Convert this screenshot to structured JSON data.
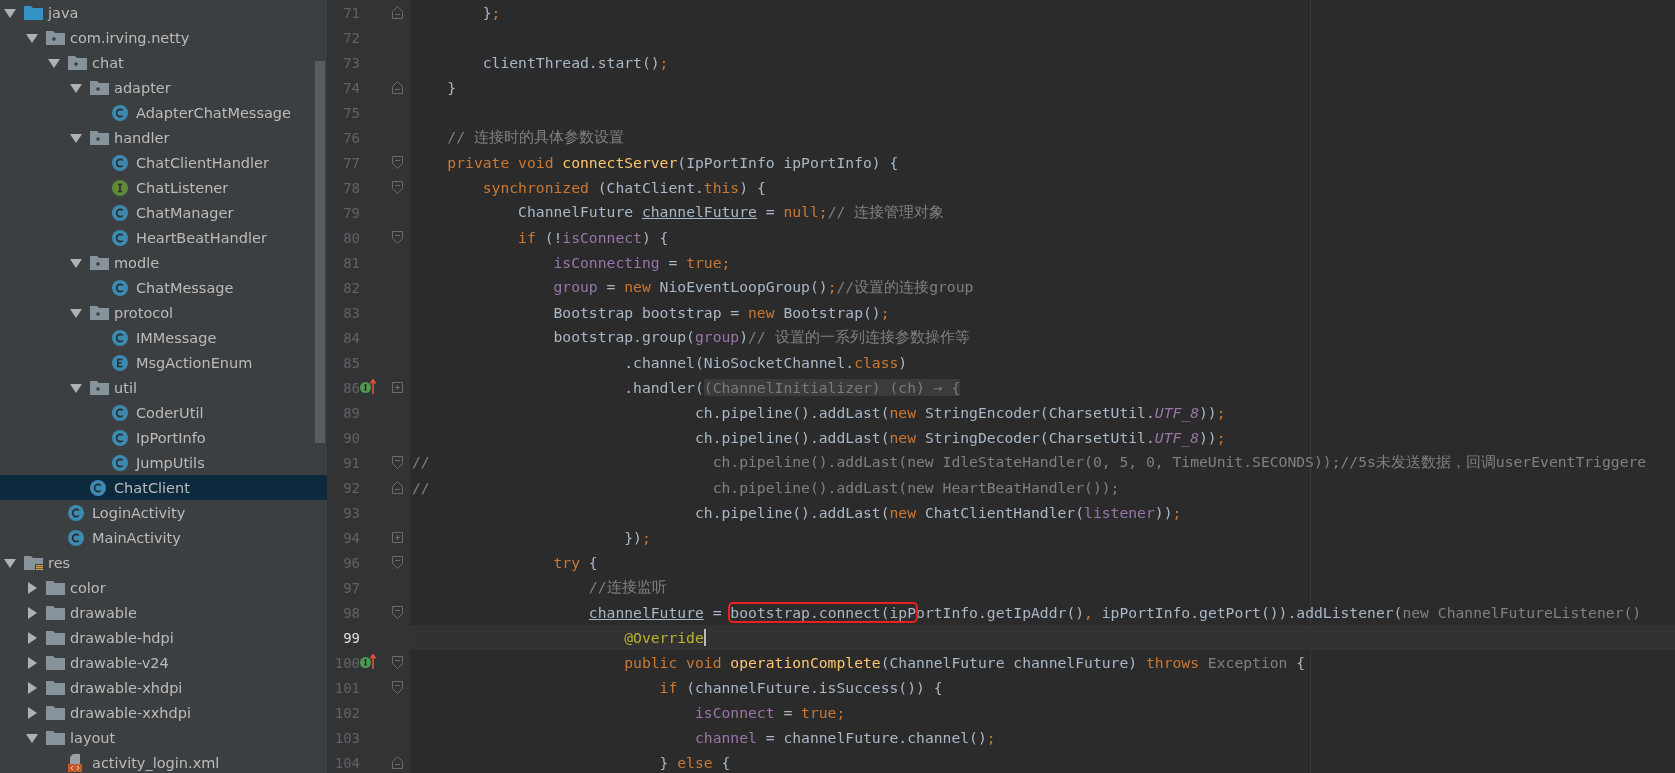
{
  "project_tree": [
    {
      "label": "java",
      "kind": "source-folder",
      "expanded": true,
      "selected": false,
      "children": [
        {
          "label": "com.irving.netty",
          "kind": "package",
          "expanded": true,
          "selected": false,
          "children": [
            {
              "label": "chat",
              "kind": "package",
              "expanded": true,
              "selected": false,
              "children": [
                {
                  "label": "adapter",
                  "kind": "package",
                  "expanded": true,
                  "selected": false,
                  "children": [
                    {
                      "label": "AdapterChatMessage",
                      "kind": "class",
                      "selected": false
                    }
                  ]
                },
                {
                  "label": "handler",
                  "kind": "package",
                  "expanded": true,
                  "selected": false,
                  "children": [
                    {
                      "label": "ChatClientHandler",
                      "kind": "class",
                      "selected": false
                    },
                    {
                      "label": "ChatListener",
                      "kind": "interface",
                      "selected": false
                    },
                    {
                      "label": "ChatManager",
                      "kind": "class",
                      "selected": false
                    },
                    {
                      "label": "HeartBeatHandler",
                      "kind": "class",
                      "selected": false
                    }
                  ]
                },
                {
                  "label": "modle",
                  "kind": "package",
                  "expanded": true,
                  "selected": false,
                  "children": [
                    {
                      "label": "ChatMessage",
                      "kind": "class",
                      "selected": false
                    }
                  ]
                },
                {
                  "label": "protocol",
                  "kind": "package",
                  "expanded": true,
                  "selected": false,
                  "children": [
                    {
                      "label": "IMMessage",
                      "kind": "class",
                      "selected": false
                    },
                    {
                      "label": "MsgActionEnum",
                      "kind": "enum",
                      "selected": false
                    }
                  ]
                },
                {
                  "label": "util",
                  "kind": "package",
                  "expanded": true,
                  "selected": false,
                  "children": [
                    {
                      "label": "CoderUtil",
                      "kind": "class",
                      "selected": false
                    },
                    {
                      "label": "IpPortInfo",
                      "kind": "class",
                      "selected": false
                    },
                    {
                      "label": "JumpUtils",
                      "kind": "class",
                      "selected": false
                    }
                  ]
                },
                {
                  "label": "ChatClient",
                  "kind": "class",
                  "selected": true
                }
              ]
            },
            {
              "label": "LoginActivity",
              "kind": "class",
              "selected": false
            },
            {
              "label": "MainActivity",
              "kind": "class",
              "selected": false
            }
          ]
        }
      ]
    },
    {
      "label": "res",
      "kind": "resource-folder",
      "expanded": true,
      "selected": false,
      "children": [
        {
          "label": "color",
          "kind": "folder",
          "expanded": false,
          "selected": false
        },
        {
          "label": "drawable",
          "kind": "folder",
          "expanded": false,
          "selected": false
        },
        {
          "label": "drawable-hdpi",
          "kind": "folder",
          "expanded": false,
          "selected": false
        },
        {
          "label": "drawable-v24",
          "kind": "folder",
          "expanded": false,
          "selected": false
        },
        {
          "label": "drawable-xhdpi",
          "kind": "folder",
          "expanded": false,
          "selected": false
        },
        {
          "label": "drawable-xxhdpi",
          "kind": "folder",
          "expanded": false,
          "selected": false
        },
        {
          "label": "layout",
          "kind": "folder",
          "expanded": true,
          "selected": false,
          "children": [
            {
              "label": "activity_login.xml",
              "kind": "xml-file",
              "selected": false
            }
          ]
        }
      ]
    }
  ],
  "code_lines": [
    {
      "number": "71",
      "fold": {
        "kind": "end"
      },
      "current": false,
      "tokens": [
        {
          "text": "        }",
          "kind": "plain"
        },
        {
          "text": ";",
          "kind": "keyword"
        }
      ]
    },
    {
      "number": "72",
      "current": false
    },
    {
      "number": "73",
      "current": false,
      "tokens": [
        {
          "text": "        clientThread.start()",
          "kind": "plain"
        },
        {
          "text": ";",
          "kind": "keyword"
        }
      ]
    },
    {
      "number": "74",
      "fold": {
        "kind": "end"
      },
      "current": false,
      "tokens": [
        {
          "text": "    }",
          "kind": "plain"
        }
      ]
    },
    {
      "number": "75",
      "current": false
    },
    {
      "number": "76",
      "current": false,
      "tokens": [
        {
          "text": "    // 连接时的具体参数设置",
          "kind": "comment"
        }
      ]
    },
    {
      "number": "77",
      "fold": {
        "kind": "open"
      },
      "current": false,
      "tokens": [
        {
          "text": "    private void ",
          "kind": "keyword"
        },
        {
          "text": "connectServer",
          "kind": "declaration"
        },
        {
          "text": "(IpPortInfo ipPortInfo) {",
          "kind": "plain"
        }
      ]
    },
    {
      "number": "78",
      "fold": {
        "kind": "open"
      },
      "current": false,
      "tokens": [
        {
          "text": "        synchronized ",
          "kind": "keyword"
        },
        {
          "text": "(ChatClient.",
          "kind": "plain"
        },
        {
          "text": "this",
          "kind": "keyword"
        },
        {
          "text": ") {",
          "kind": "plain"
        }
      ]
    },
    {
      "number": "79",
      "current": false,
      "tokens": [
        {
          "text": "            ChannelFuture ",
          "kind": "plain"
        },
        {
          "text": "channelFuture",
          "kind": "underlined"
        },
        {
          "text": " = ",
          "kind": "plain"
        },
        {
          "text": "null;",
          "kind": "keyword"
        },
        {
          "text": "// 连接管理对象",
          "kind": "comment"
        }
      ]
    },
    {
      "number": "80",
      "fold": {
        "kind": "open"
      },
      "current": false,
      "tokens": [
        {
          "text": "            if ",
          "kind": "keyword"
        },
        {
          "text": "(!",
          "kind": "plain"
        },
        {
          "text": "isConnect",
          "kind": "field"
        },
        {
          "text": ") {",
          "kind": "plain"
        }
      ]
    },
    {
      "number": "81",
      "current": false,
      "tokens": [
        {
          "text": "                isConnecting",
          "kind": "field"
        },
        {
          "text": " = ",
          "kind": "plain"
        },
        {
          "text": "true;",
          "kind": "keyword"
        }
      ]
    },
    {
      "number": "82",
      "current": false,
      "tokens": [
        {
          "text": "                group",
          "kind": "field"
        },
        {
          "text": " = ",
          "kind": "plain"
        },
        {
          "text": "new ",
          "kind": "keyword"
        },
        {
          "text": "NioEventLoopGroup()",
          "kind": "plain"
        },
        {
          "text": ";",
          "kind": "keyword"
        },
        {
          "text": "//设置的连接group",
          "kind": "comment"
        }
      ]
    },
    {
      "number": "83",
      "current": false,
      "tokens": [
        {
          "text": "                Bootstrap bootstrap = ",
          "kind": "plain"
        },
        {
          "text": "new ",
          "kind": "keyword"
        },
        {
          "text": "Bootstrap()",
          "kind": "plain"
        },
        {
          "text": ";",
          "kind": "keyword"
        }
      ]
    },
    {
      "number": "84",
      "current": false,
      "tokens": [
        {
          "text": "                bootstrap.group(",
          "kind": "plain"
        },
        {
          "text": "group",
          "kind": "field"
        },
        {
          "text": ")",
          "kind": "plain"
        },
        {
          "text": "// 设置的一系列连接参数操作等",
          "kind": "comment"
        }
      ]
    },
    {
      "number": "85",
      "current": false,
      "tokens": [
        {
          "text": "                        .channel(NioSocketChannel.",
          "kind": "plain"
        },
        {
          "text": "class",
          "kind": "keyword"
        },
        {
          "text": ")",
          "kind": "plain"
        }
      ]
    },
    {
      "number": "86",
      "fold": {
        "kind": "closed"
      },
      "override": true,
      "current": false,
      "tokens": [
        {
          "text": "                        .handler(",
          "kind": "plain"
        },
        {
          "text": "(ChannelInitializer) (ch) → {",
          "kind": "folded"
        }
      ]
    },
    {
      "number": "89",
      "current": false,
      "tokens": [
        {
          "text": "                                ch.pipeline().addLast(",
          "kind": "plain"
        },
        {
          "text": "new ",
          "kind": "keyword"
        },
        {
          "text": "StringEncoder(CharsetUtil.",
          "kind": "plain"
        },
        {
          "text": "UTF_8",
          "kind": "static"
        },
        {
          "text": "))",
          "kind": "plain"
        },
        {
          "text": ";",
          "kind": "keyword"
        }
      ]
    },
    {
      "number": "90",
      "current": false,
      "tokens": [
        {
          "text": "                                ch.pipeline().addLast(",
          "kind": "plain"
        },
        {
          "text": "new ",
          "kind": "keyword"
        },
        {
          "text": "StringDecoder(CharsetUtil.",
          "kind": "plain"
        },
        {
          "text": "UTF_8",
          "kind": "static"
        },
        {
          "text": "))",
          "kind": "plain"
        },
        {
          "text": ";",
          "kind": "keyword"
        }
      ]
    },
    {
      "number": "91",
      "fold": {
        "kind": "open"
      },
      "current": false,
      "tokens": [
        {
          "text": "//                                ch.pipeline().addLast(new IdleStateHandler(0, 5, 0, TimeUnit.SECONDS));//5s未发送数据，回调userEventTriggere",
          "kind": "comment"
        }
      ]
    },
    {
      "number": "92",
      "fold": {
        "kind": "end"
      },
      "current": false,
      "tokens": [
        {
          "text": "//                                ch.pipeline().addLast(new HeartBeatHandler());",
          "kind": "comment"
        }
      ]
    },
    {
      "number": "93",
      "current": false,
      "tokens": [
        {
          "text": "                                ch.pipeline().addLast(",
          "kind": "plain"
        },
        {
          "text": "new ",
          "kind": "keyword"
        },
        {
          "text": "ChatClientHandler(",
          "kind": "plain"
        },
        {
          "text": "listener",
          "kind": "field"
        },
        {
          "text": "))",
          "kind": "plain"
        },
        {
          "text": ";",
          "kind": "keyword"
        }
      ]
    },
    {
      "number": "94",
      "fold": {
        "kind": "closed"
      },
      "current": false,
      "tokens": [
        {
          "text": "                        })",
          "kind": "plain"
        },
        {
          "text": ";",
          "kind": "keyword"
        }
      ]
    },
    {
      "number": "96",
      "fold": {
        "kind": "open"
      },
      "current": false,
      "tokens": [
        {
          "text": "                try ",
          "kind": "keyword"
        },
        {
          "text": "{",
          "kind": "plain"
        }
      ]
    },
    {
      "number": "97",
      "current": false,
      "tokens": [
        {
          "text": "                    //连接监听",
          "kind": "comment"
        }
      ]
    },
    {
      "number": "98",
      "fold": {
        "kind": "open"
      },
      "current": false,
      "tokens": [
        {
          "text": "                    channelFuture",
          "kind": "underlined"
        },
        {
          "text": " = ",
          "kind": "plain"
        },
        {
          "text": "bootstrap.connect(ipP",
          "kind": "plain",
          "marked": true
        },
        {
          "text": "ortInfo.getIpAddr()",
          "kind": "plain"
        },
        {
          "text": ", ",
          "kind": "keyword"
        },
        {
          "text": "ipPortInfo.getPort()).addListener(",
          "kind": "plain"
        },
        {
          "text": "new ChannelFutureListener()",
          "kind": "muted"
        }
      ]
    },
    {
      "number": "99",
      "current": true,
      "tokens": [
        {
          "text": "                        @Override",
          "kind": "annotation"
        }
      ]
    },
    {
      "number": "100",
      "fold": {
        "kind": "open"
      },
      "override": true,
      "current": false,
      "tokens": [
        {
          "text": "                        public void ",
          "kind": "keyword"
        },
        {
          "text": "operationComplete",
          "kind": "declaration"
        },
        {
          "text": "(ChannelFuture channelFuture) ",
          "kind": "plain"
        },
        {
          "text": "throws ",
          "kind": "keyword"
        },
        {
          "text": "Exception ",
          "kind": "muted"
        },
        {
          "text": "{",
          "kind": "plain"
        }
      ]
    },
    {
      "number": "101",
      "fold": {
        "kind": "open"
      },
      "current": false,
      "tokens": [
        {
          "text": "                            if ",
          "kind": "keyword"
        },
        {
          "text": "(channelFuture.isSuccess()) {",
          "kind": "plain"
        }
      ]
    },
    {
      "number": "102",
      "current": false,
      "tokens": [
        {
          "text": "                                isConnect",
          "kind": "field"
        },
        {
          "text": " = ",
          "kind": "plain"
        },
        {
          "text": "true;",
          "kind": "keyword"
        }
      ]
    },
    {
      "number": "103",
      "current": false,
      "tokens": [
        {
          "text": "                                channel",
          "kind": "field"
        },
        {
          "text": " = channelFuture.channel()",
          "kind": "plain"
        },
        {
          "text": ";",
          "kind": "keyword"
        }
      ]
    },
    {
      "number": "104",
      "fold": {
        "kind": "end"
      },
      "current": false,
      "tokens": [
        {
          "text": "                            } ",
          "kind": "plain"
        },
        {
          "text": "else ",
          "kind": "keyword"
        },
        {
          "text": "{",
          "kind": "plain"
        }
      ]
    }
  ]
}
